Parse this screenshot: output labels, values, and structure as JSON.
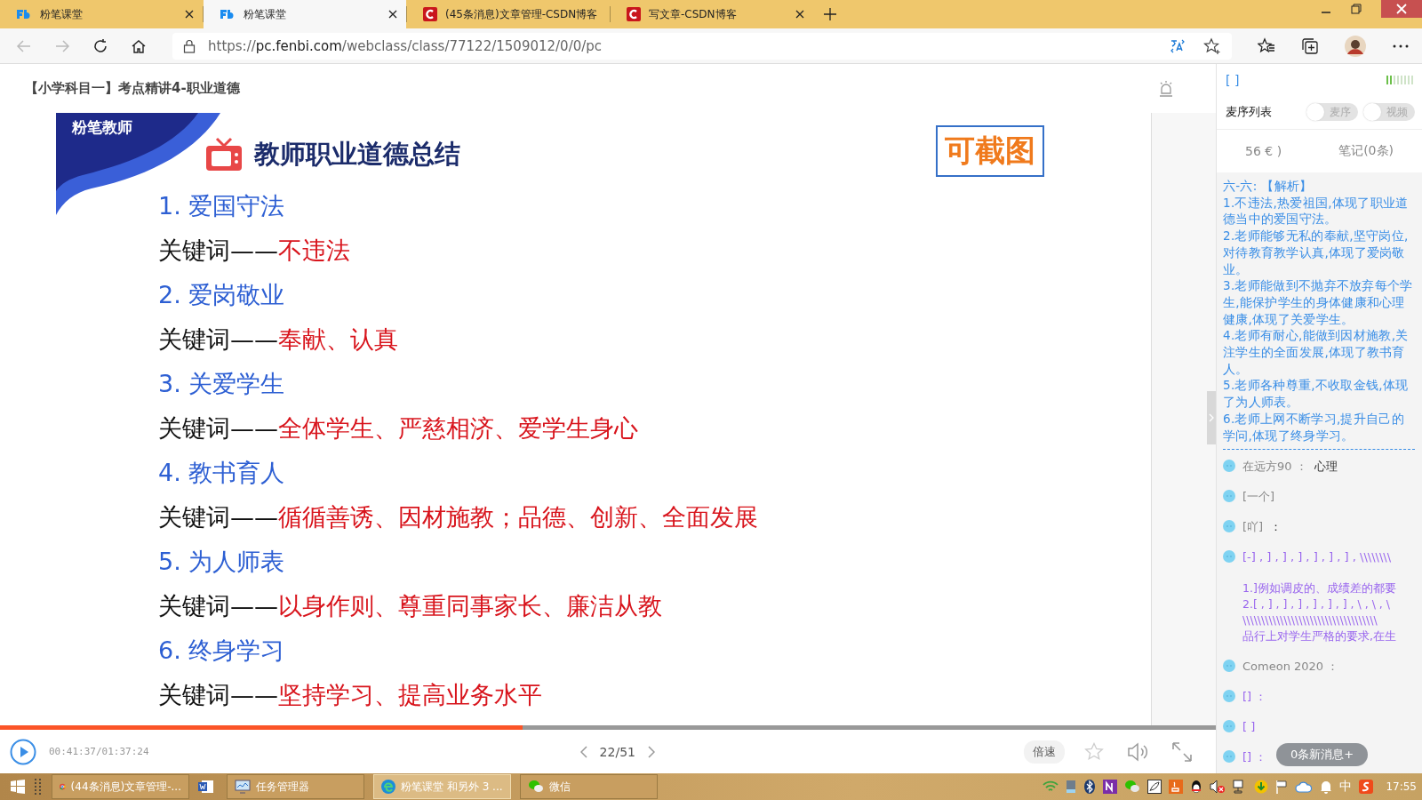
{
  "browser": {
    "tabs": [
      {
        "label": "粉笔课堂",
        "kind": "fenbi",
        "selected": false
      },
      {
        "label": "粉笔课堂",
        "kind": "fenbi",
        "selected": true
      },
      {
        "label": "(45条消息)文章管理-CSDN博客",
        "kind": "csdn",
        "selected": false
      },
      {
        "label": "写文章-CSDN博客",
        "kind": "csdn",
        "selected": false
      }
    ],
    "url": {
      "scheme": "https://",
      "host": "pc.fenbi.com",
      "path": "/webclass/class/77122/1509012/0/0/pc"
    }
  },
  "page": {
    "title": "【小学科目一】考点精讲4-职业道德",
    "slide": {
      "brand": "粉笔教师",
      "heading": "教师职业道德总结",
      "stamp": "可截图",
      "items": [
        {
          "title": "1. 爱国守法",
          "label": "关键词——",
          "keywords": "不违法"
        },
        {
          "title": "2. 爱岗敬业",
          "label": "关键词——",
          "keywords": "奉献、认真"
        },
        {
          "title": "3. 关爱学生",
          "label": "关键词——",
          "keywords": "全体学生、严慈相济、爱学生身心"
        },
        {
          "title": "4.  教书育人",
          "label": "关键词——",
          "keywords": "循循善诱、因材施教；品德、创新、全面发展"
        },
        {
          "title": "5. 为人师表",
          "label": "关键词——",
          "keywords": "以身作则、尊重同事家长、廉洁从教"
        },
        {
          "title": "6. 终身学习",
          "label": "关键词——",
          "keywords": "坚持学习、提高业务水平"
        }
      ]
    },
    "player": {
      "level": 0.43,
      "time": "00:41:37/01:37:24",
      "page": "22/51",
      "speed": "倍速"
    }
  },
  "side_panel": {
    "status": "[ ]",
    "list_title": "麦序列表",
    "toggles": [
      {
        "label": "麦序",
        "on": false
      },
      {
        "label": "视频",
        "on": false
      }
    ],
    "tabs": [
      "56 € )",
      "笔记(0条)"
    ],
    "notes": [
      "六-六: 【解析】",
      "1.不违法,热爱祖国,体现了职业道德当中的爱国守法。",
      "2.老师能够无私的奉献,坚守岗位,对待教育教学认真,体现了爱岗敬业。",
      "3.老师能做到不抛弃不放弃每个学生,能保护学生的身体健康和心理健康,体现了关爱学生。",
      "4.老师有耐心,能做到因材施教,关注学生的全面发展,体现了教书育人。",
      "5.老师各种尊重,不收取金钱,体现了为人师表。",
      "6.老师上网不断学习,提升自己的学问,体现了终身学习。"
    ],
    "chat": [
      {
        "kind": "plain",
        "author": "在远方90 ：",
        "text": "心理"
      },
      {
        "kind": "plain",
        "author": "[一个]"
      },
      {
        "kind": "plain",
        "author": "[吖]",
        "text": "："
      },
      {
        "kind": "purple",
        "author": "[-] , ] , ] , ] , ] , ] , ] , \\\\\\\\\\\\\\\\",
        "lines": [
          "1.]例如调皮的、成绩差的都要",
          "2.[ , ] , ] , ] , ] , ] , ] , \\ , \\ , \\",
          "\\\\\\\\\\\\\\\\\\\\\\\\\\\\\\\\\\\\\\\\\\\\\\\\\\\\\\\\\\\\\\\\\\\\\\\\",
          "品行上对学生严格的要求,在生"
        ]
      },
      {
        "kind": "plain",
        "author": "Comeon 2020 ："
      },
      {
        "kind": "purple",
        "author": "[] ："
      },
      {
        "kind": "purple",
        "author": "[ ]"
      },
      {
        "kind": "purple",
        "author": "[] ："
      }
    ],
    "new_messages": "0条新消息+"
  },
  "taskbar": {
    "items": [
      {
        "kind": "chrome",
        "label": "(44条消息)文章管理-...",
        "selected": false
      },
      {
        "kind": "word",
        "selected": false
      },
      {
        "kind": "monitor",
        "label": "任务管理器",
        "selected": false
      },
      {
        "kind": "edge",
        "label": "粉笔课堂 和另外 3 ...",
        "selected": true
      },
      {
        "kind": "wechat",
        "label": "微信",
        "selected": false
      }
    ],
    "ime": "中",
    "clock": "17:55"
  }
}
